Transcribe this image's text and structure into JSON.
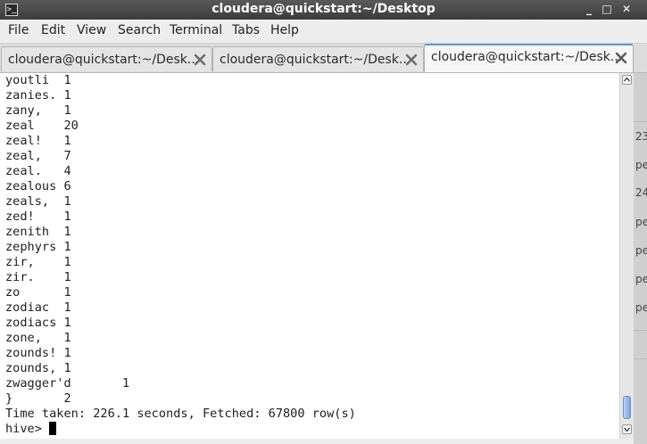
{
  "window": {
    "title": "cloudera@quickstart:~/Desktop",
    "icon_name": "terminal-app-icon",
    "minimize": "_",
    "maximize": "□",
    "close": "✕"
  },
  "menu": [
    "File",
    "Edit",
    "View",
    "Search",
    "Terminal",
    "Tabs",
    "Help"
  ],
  "tabs": [
    {
      "label": "cloudera@quickstart:~/Desk...",
      "active": false
    },
    {
      "label": "cloudera@quickstart:~/Desk...",
      "active": false
    },
    {
      "label": "cloudera@quickstart:~/Desk...",
      "active": true
    }
  ],
  "terminal": {
    "lines": [
      "youtli  1",
      "zanies. 1",
      "zany,   1",
      "zeal    20",
      "zeal!   1",
      "zeal,   7",
      "zeal.   4",
      "zealous 6",
      "zeals,  1",
      "zed!    1",
      "zenith  1",
      "zephyrs 1",
      "zir,    1",
      "zir.    1",
      "zo      1",
      "zodiac  1",
      "zodiacs 1",
      "zone,   1",
      "zounds! 1",
      "zounds, 1",
      "zwagger'd       1",
      "}       2",
      "Time taken: 226.1 seconds, Fetched: 67800 row(s)"
    ],
    "prompt": "hive> "
  },
  "background_fragments": [
    "23",
    "pe",
    "24",
    "pe",
    "pe",
    "pe",
    "pe"
  ],
  "colors": {
    "active_tab_accent": "#6b93c9",
    "scroll_thumb": "#7fa6dd"
  }
}
